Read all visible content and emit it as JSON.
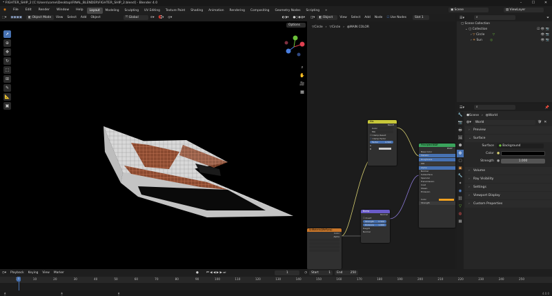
{
  "window": {
    "title": "* FIGHTER_SHIP_2 [C:\\Users\\come\\Desktop\\FINAL_BLENDER\\FIGHTER_SHIP_2.blend] - Blender 4.0"
  },
  "menu": [
    "File",
    "Edit",
    "Render",
    "Window",
    "Help"
  ],
  "workspaces": [
    "Layout",
    "Modeling",
    "Sculpting",
    "UV Editing",
    "Texture Paint",
    "Shading",
    "Animation",
    "Rendering",
    "Compositing",
    "Geometry Nodes",
    "Scripting"
  ],
  "scene_field": "Scene",
  "view_layer_field": "ViewLayer",
  "viewport": {
    "mode": "Object Mode",
    "menus": [
      "View",
      "Select",
      "Add",
      "Object"
    ],
    "transform": "Global",
    "options_label": "Options"
  },
  "node_editor": {
    "type": "Object",
    "menus": [
      "View",
      "Select",
      "Add",
      "Node"
    ],
    "use_nodes": "Use Nodes",
    "slot": "Slot 1",
    "breadcrumb": [
      "Circle",
      "Circle",
      "MAIN COLOR"
    ],
    "nodes": {
      "mix": {
        "title": "Mix",
        "result": "Result",
        "type": "Color",
        "blend": "Mix",
        "clamp_result": "Clamp Result",
        "clamp_factor": "Clamp Factor",
        "factor_label": "Factor",
        "factor_value": "0.500",
        "a": "A",
        "b": "B"
      },
      "bsdf": {
        "title": "Principled BSDF",
        "rows": [
          "BSDF",
          "Base Color",
          "Metallic",
          "Roughness",
          "IOR",
          "Alpha",
          "Normal",
          "Subsurface",
          "Specular",
          "Transmission",
          "Coat",
          "Sheen",
          "Emission",
          "Color",
          "Strength"
        ]
      },
      "bump": {
        "title": "Bump",
        "normal": "Normal",
        "invert": "Invert",
        "strength_label": "Strength",
        "strength_value": "0.500",
        "distance_label": "Distance",
        "distance_value": "1.000",
        "height": "Height",
        "normal_in": "Normal"
      },
      "image": {
        "title": "SciMaterial(WeP.png)",
        "color": "Color",
        "alpha": "Alpha"
      }
    }
  },
  "outliner": {
    "root": "Scene Collection",
    "items": [
      {
        "name": "Collection",
        "level": 1
      },
      {
        "name": "Circle",
        "level": 2
      },
      {
        "name": "Sun",
        "level": 2
      }
    ]
  },
  "properties": {
    "breadcrumb": [
      "Scene",
      "World"
    ],
    "world_name": "World",
    "panels_top": [
      "Preview",
      "Surface"
    ],
    "surface_label": "Surface",
    "surface_value": "Background",
    "color_label": "Color",
    "strength_label": "Strength",
    "strength_value": "1.000",
    "panels_bottom": [
      "Volume",
      "Ray Visibility",
      "Settings",
      "Viewport Display",
      "Custom Properties"
    ]
  },
  "timeline": {
    "menus": [
      "Playback",
      "Keying",
      "View",
      "Marker"
    ],
    "current_frame": "1",
    "start_label": "Start",
    "start": "1",
    "end_label": "End",
    "end": "250",
    "ticks": [
      "1",
      "10",
      "20",
      "30",
      "40",
      "50",
      "60",
      "70",
      "80",
      "90",
      "100",
      "110",
      "120",
      "130",
      "140",
      "150",
      "160",
      "170",
      "180",
      "190",
      "200",
      "210",
      "220",
      "230",
      "240",
      "250"
    ],
    "version": "4.0.0"
  },
  "colors": {
    "accent": "#4772b3",
    "world_color": "#000000",
    "mix_header": "#c8c83a",
    "bsdf_header": "#3aa35c",
    "bump_header": "#6a5bc8",
    "image_header": "#c8762a",
    "wire_yellow": "#d8d070",
    "wire_purple": "#8c7ad8"
  }
}
